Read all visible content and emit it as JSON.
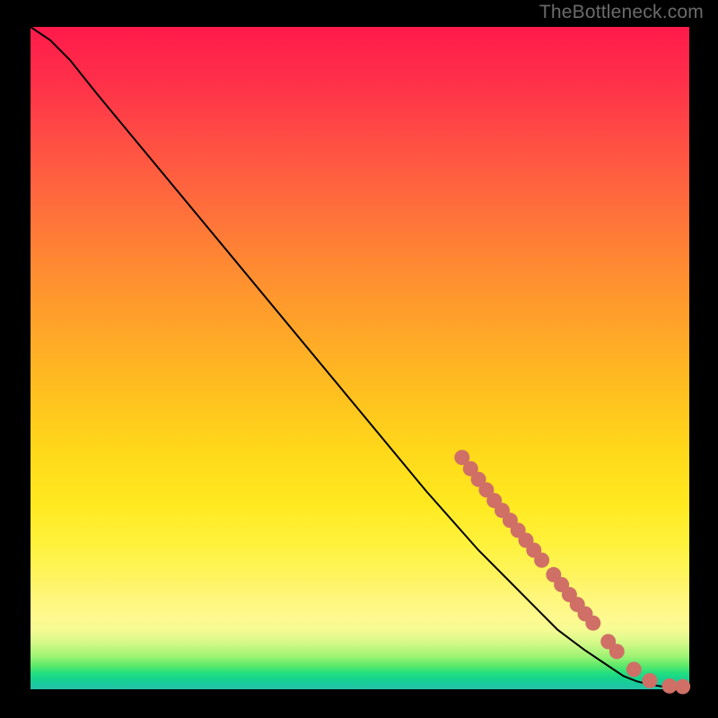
{
  "watermark": "TheBottleneck.com",
  "colors": {
    "dot": "#cf6f66",
    "curve": "#000000"
  },
  "chart_data": {
    "type": "line",
    "title": "",
    "xlabel": "",
    "ylabel": "",
    "xlim": [
      0,
      100
    ],
    "ylim": [
      0,
      100
    ],
    "grid": false,
    "series": [
      {
        "name": "bottleneck-curve",
        "x": [
          0,
          3,
          6,
          10,
          15,
          20,
          30,
          40,
          50,
          60,
          68,
          72,
          76,
          80,
          84,
          87,
          90,
          92,
          94,
          96,
          98,
          100
        ],
        "y": [
          100,
          98,
          95,
          90,
          84,
          78,
          66,
          54,
          42,
          30,
          21,
          17,
          13,
          9,
          6,
          4,
          2,
          1.2,
          0.7,
          0.4,
          0.2,
          0.1
        ]
      }
    ],
    "markers": [
      {
        "x": 65.5,
        "y": 35.0
      },
      {
        "x": 66.8,
        "y": 33.3
      },
      {
        "x": 68.0,
        "y": 31.7
      },
      {
        "x": 69.2,
        "y": 30.1
      },
      {
        "x": 70.4,
        "y": 28.5
      },
      {
        "x": 71.6,
        "y": 27.0
      },
      {
        "x": 72.8,
        "y": 25.5
      },
      {
        "x": 74.0,
        "y": 24.0
      },
      {
        "x": 75.2,
        "y": 22.5
      },
      {
        "x": 76.4,
        "y": 21.0
      },
      {
        "x": 77.6,
        "y": 19.5
      },
      {
        "x": 79.4,
        "y": 17.3
      },
      {
        "x": 80.6,
        "y": 15.8
      },
      {
        "x": 81.8,
        "y": 14.3
      },
      {
        "x": 83.0,
        "y": 12.8
      },
      {
        "x": 84.2,
        "y": 11.4
      },
      {
        "x": 85.4,
        "y": 10.0
      },
      {
        "x": 87.7,
        "y": 7.2
      },
      {
        "x": 89.0,
        "y": 5.7
      },
      {
        "x": 91.6,
        "y": 3.0
      },
      {
        "x": 94.0,
        "y": 1.3
      },
      {
        "x": 97.0,
        "y": 0.5
      },
      {
        "x": 99.0,
        "y": 0.4
      }
    ]
  }
}
